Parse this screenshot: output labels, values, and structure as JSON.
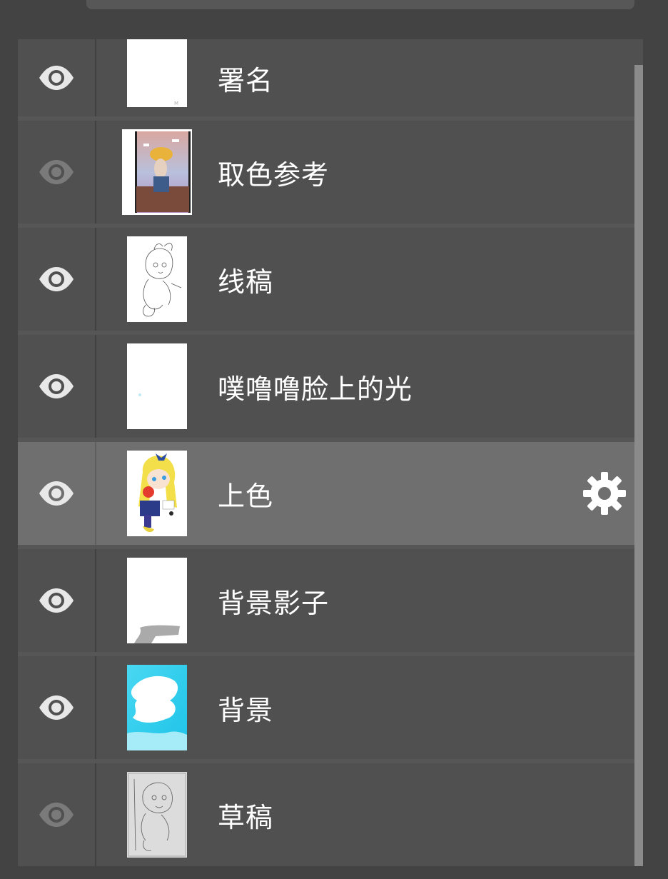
{
  "layers": [
    {
      "name": "署名",
      "visible": true,
      "selected": false,
      "thumbnail": "signature"
    },
    {
      "name": "取色参考",
      "visible": false,
      "selected": false,
      "thumbnail": "color-reference-illustration"
    },
    {
      "name": "线稿",
      "visible": true,
      "selected": false,
      "thumbnail": "lineart"
    },
    {
      "name": "噗噜噜脸上的光",
      "visible": true,
      "selected": false,
      "thumbnail": "face-light"
    },
    {
      "name": "上色",
      "visible": true,
      "selected": true,
      "thumbnail": "coloring"
    },
    {
      "name": "背景影子",
      "visible": true,
      "selected": false,
      "thumbnail": "background-shadow"
    },
    {
      "name": "背景",
      "visible": true,
      "selected": false,
      "thumbnail": "background-cyan"
    },
    {
      "name": "草稿",
      "visible": false,
      "selected": false,
      "thumbnail": "sketch"
    }
  ],
  "icons": {
    "visibility": "eye-icon",
    "settings": "gear-icon"
  },
  "colors": {
    "panel_bg": "#505050",
    "selected_row": "#6f6f6f",
    "eye_visible": "#e8e8e8",
    "eye_hidden": "#7a7a7a",
    "text": "#ffffff"
  }
}
